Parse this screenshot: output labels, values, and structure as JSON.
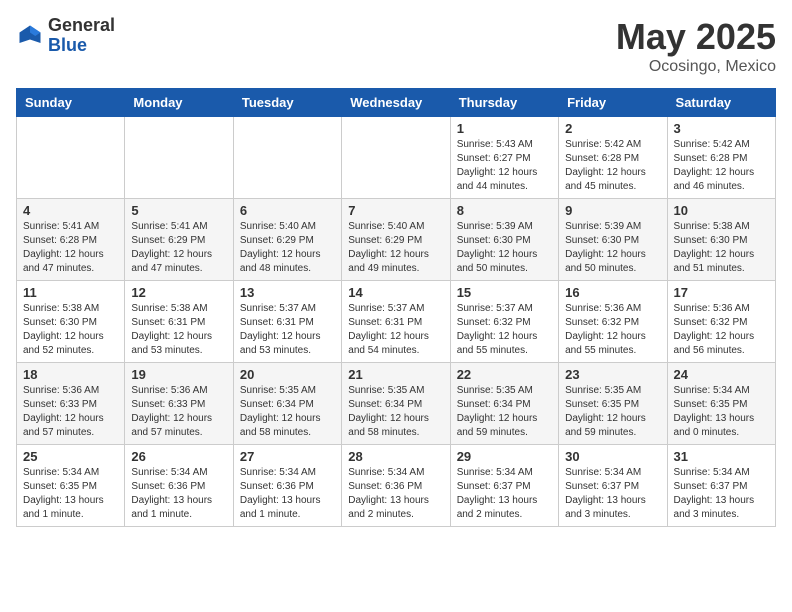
{
  "header": {
    "logo_general": "General",
    "logo_blue": "Blue",
    "month_year": "May 2025",
    "location": "Ocosingo, Mexico"
  },
  "weekdays": [
    "Sunday",
    "Monday",
    "Tuesday",
    "Wednesday",
    "Thursday",
    "Friday",
    "Saturday"
  ],
  "weeks": [
    [
      {
        "day": "",
        "info": ""
      },
      {
        "day": "",
        "info": ""
      },
      {
        "day": "",
        "info": ""
      },
      {
        "day": "",
        "info": ""
      },
      {
        "day": "1",
        "info": "Sunrise: 5:43 AM\nSunset: 6:27 PM\nDaylight: 12 hours\nand 44 minutes."
      },
      {
        "day": "2",
        "info": "Sunrise: 5:42 AM\nSunset: 6:28 PM\nDaylight: 12 hours\nand 45 minutes."
      },
      {
        "day": "3",
        "info": "Sunrise: 5:42 AM\nSunset: 6:28 PM\nDaylight: 12 hours\nand 46 minutes."
      }
    ],
    [
      {
        "day": "4",
        "info": "Sunrise: 5:41 AM\nSunset: 6:28 PM\nDaylight: 12 hours\nand 47 minutes."
      },
      {
        "day": "5",
        "info": "Sunrise: 5:41 AM\nSunset: 6:29 PM\nDaylight: 12 hours\nand 47 minutes."
      },
      {
        "day": "6",
        "info": "Sunrise: 5:40 AM\nSunset: 6:29 PM\nDaylight: 12 hours\nand 48 minutes."
      },
      {
        "day": "7",
        "info": "Sunrise: 5:40 AM\nSunset: 6:29 PM\nDaylight: 12 hours\nand 49 minutes."
      },
      {
        "day": "8",
        "info": "Sunrise: 5:39 AM\nSunset: 6:30 PM\nDaylight: 12 hours\nand 50 minutes."
      },
      {
        "day": "9",
        "info": "Sunrise: 5:39 AM\nSunset: 6:30 PM\nDaylight: 12 hours\nand 50 minutes."
      },
      {
        "day": "10",
        "info": "Sunrise: 5:38 AM\nSunset: 6:30 PM\nDaylight: 12 hours\nand 51 minutes."
      }
    ],
    [
      {
        "day": "11",
        "info": "Sunrise: 5:38 AM\nSunset: 6:30 PM\nDaylight: 12 hours\nand 52 minutes."
      },
      {
        "day": "12",
        "info": "Sunrise: 5:38 AM\nSunset: 6:31 PM\nDaylight: 12 hours\nand 53 minutes."
      },
      {
        "day": "13",
        "info": "Sunrise: 5:37 AM\nSunset: 6:31 PM\nDaylight: 12 hours\nand 53 minutes."
      },
      {
        "day": "14",
        "info": "Sunrise: 5:37 AM\nSunset: 6:31 PM\nDaylight: 12 hours\nand 54 minutes."
      },
      {
        "day": "15",
        "info": "Sunrise: 5:37 AM\nSunset: 6:32 PM\nDaylight: 12 hours\nand 55 minutes."
      },
      {
        "day": "16",
        "info": "Sunrise: 5:36 AM\nSunset: 6:32 PM\nDaylight: 12 hours\nand 55 minutes."
      },
      {
        "day": "17",
        "info": "Sunrise: 5:36 AM\nSunset: 6:32 PM\nDaylight: 12 hours\nand 56 minutes."
      }
    ],
    [
      {
        "day": "18",
        "info": "Sunrise: 5:36 AM\nSunset: 6:33 PM\nDaylight: 12 hours\nand 57 minutes."
      },
      {
        "day": "19",
        "info": "Sunrise: 5:36 AM\nSunset: 6:33 PM\nDaylight: 12 hours\nand 57 minutes."
      },
      {
        "day": "20",
        "info": "Sunrise: 5:35 AM\nSunset: 6:34 PM\nDaylight: 12 hours\nand 58 minutes."
      },
      {
        "day": "21",
        "info": "Sunrise: 5:35 AM\nSunset: 6:34 PM\nDaylight: 12 hours\nand 58 minutes."
      },
      {
        "day": "22",
        "info": "Sunrise: 5:35 AM\nSunset: 6:34 PM\nDaylight: 12 hours\nand 59 minutes."
      },
      {
        "day": "23",
        "info": "Sunrise: 5:35 AM\nSunset: 6:35 PM\nDaylight: 12 hours\nand 59 minutes."
      },
      {
        "day": "24",
        "info": "Sunrise: 5:34 AM\nSunset: 6:35 PM\nDaylight: 13 hours\nand 0 minutes."
      }
    ],
    [
      {
        "day": "25",
        "info": "Sunrise: 5:34 AM\nSunset: 6:35 PM\nDaylight: 13 hours\nand 1 minute."
      },
      {
        "day": "26",
        "info": "Sunrise: 5:34 AM\nSunset: 6:36 PM\nDaylight: 13 hours\nand 1 minute."
      },
      {
        "day": "27",
        "info": "Sunrise: 5:34 AM\nSunset: 6:36 PM\nDaylight: 13 hours\nand 1 minute."
      },
      {
        "day": "28",
        "info": "Sunrise: 5:34 AM\nSunset: 6:36 PM\nDaylight: 13 hours\nand 2 minutes."
      },
      {
        "day": "29",
        "info": "Sunrise: 5:34 AM\nSunset: 6:37 PM\nDaylight: 13 hours\nand 2 minutes."
      },
      {
        "day": "30",
        "info": "Sunrise: 5:34 AM\nSunset: 6:37 PM\nDaylight: 13 hours\nand 3 minutes."
      },
      {
        "day": "31",
        "info": "Sunrise: 5:34 AM\nSunset: 6:37 PM\nDaylight: 13 hours\nand 3 minutes."
      }
    ]
  ]
}
